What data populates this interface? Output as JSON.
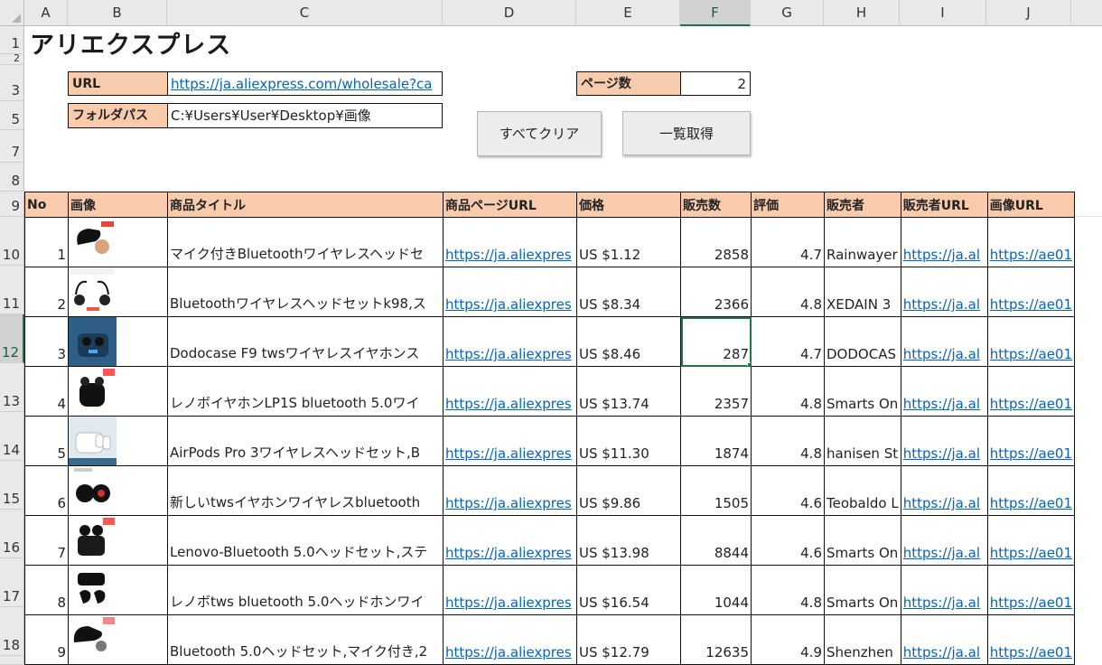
{
  "columns": [
    "A",
    "B",
    "C",
    "D",
    "E",
    "F",
    "G",
    "H",
    "I",
    "J"
  ],
  "selected_column": "F",
  "rows_top": [
    "1",
    "2",
    "3",
    "5",
    "7",
    "8",
    "9"
  ],
  "rows_data": [
    "10",
    "11",
    "12",
    "13",
    "14",
    "15",
    "16",
    "17",
    "18"
  ],
  "selected_row": "12",
  "title": "アリエクスプレス",
  "url_label": "URL",
  "url_value": "https://ja.aliexpress.com/wholesale?ca",
  "folder_label": "フォルダパス",
  "folder_value": "C:¥Users¥User¥Desktop¥画像",
  "pages_label": "ページ数",
  "pages_value": "2",
  "buttons": {
    "clear_all": "すべてクリア",
    "fetch_list": "一覧取得"
  },
  "table": {
    "headers": [
      "No",
      "画像",
      "商品タイトル",
      "商品ページURL",
      "価格",
      "販売数",
      "評価",
      "販売者",
      "販売者URL",
      "画像URL"
    ],
    "rows": [
      {
        "no": "1",
        "title": "マイク付きBluetoothワイヤレスヘッドセ",
        "url": "https://ja.aliexpres",
        "price": "US $1.12",
        "sales": "2858",
        "rating": "4.7",
        "seller": "Rainwayer",
        "seller_url": "https://ja.al",
        "img_url": "https://ae01",
        "thumb": "bluetooth-headset-image"
      },
      {
        "no": "2",
        "title": "Bluetoothワイヤレスヘッドセットk98,ス",
        "url": "https://ja.aliexpres",
        "price": "US $8.34",
        "sales": "2366",
        "rating": "4.8",
        "seller": "XEDAIN 3",
        "seller_url": "https://ja.al",
        "img_url": "https://ae01",
        "thumb": "sport-earphones-image"
      },
      {
        "no": "3",
        "title": "Dodocase F9 twsワイヤレスイヤホンス",
        "url": "https://ja.aliexpres",
        "price": "US $8.46",
        "sales": "287",
        "rating": "4.7",
        "seller": "DODOCAS",
        "seller_url": "https://ja.al",
        "img_url": "https://ae01",
        "thumb": "earbuds-case-blue-image"
      },
      {
        "no": "4",
        "title": "レノボイヤホンLP1S bluetooth 5.0ワイ",
        "url": "https://ja.aliexpres",
        "price": "US $13.74",
        "sales": "2357",
        "rating": "4.8",
        "seller": "Smarts On",
        "seller_url": "https://ja.al",
        "img_url": "https://ae01",
        "thumb": "black-earbuds-image"
      },
      {
        "no": "5",
        "title": "AirPods Pro 3ワイヤレスヘッドセット,B",
        "url": "https://ja.aliexpres",
        "price": "US $11.30",
        "sales": "1874",
        "rating": "4.8",
        "seller": "hanisen St",
        "seller_url": "https://ja.al",
        "img_url": "https://ae01",
        "thumb": "airpods-pro-image"
      },
      {
        "no": "6",
        "title": "新しいtwsイヤホンワイヤレスbluetooth",
        "url": "https://ja.aliexpres",
        "price": "US $9.86",
        "sales": "1505",
        "rating": "4.6",
        "seller": "Teobaldo L",
        "seller_url": "https://ja.al",
        "img_url": "https://ae01",
        "thumb": "tws-earphones-image"
      },
      {
        "no": "7",
        "title": "Lenovo-Bluetooth 5.0ヘッドセット,ステ",
        "url": "https://ja.aliexpres",
        "price": "US $13.98",
        "sales": "8844",
        "rating": "4.6",
        "seller": "Smarts On",
        "seller_url": "https://ja.al",
        "img_url": "https://ae01",
        "thumb": "lenovo-headset-image"
      },
      {
        "no": "8",
        "title": "レノボtws bluetooth 5.0ヘッドホンワイ",
        "url": "https://ja.aliexpres",
        "price": "US $16.54",
        "sales": "1044",
        "rating": "4.8",
        "seller": "Smarts On",
        "seller_url": "https://ja.al",
        "img_url": "https://ae01",
        "thumb": "lenovo-tws-image"
      },
      {
        "no": "9",
        "title": "Bluetooth 5.0ヘッドセット,マイク付き,2",
        "url": "https://ja.aliexpres",
        "price": "US $12.79",
        "sales": "12635",
        "rating": "4.9",
        "seller": "Shenzhen",
        "seller_url": "https://ja.al",
        "img_url": "https://ae01",
        "thumb": "earhook-headset-image"
      }
    ]
  },
  "colors": {
    "header_fill": "#f8cbad",
    "link": "#0563c1",
    "selection": "#217346"
  }
}
